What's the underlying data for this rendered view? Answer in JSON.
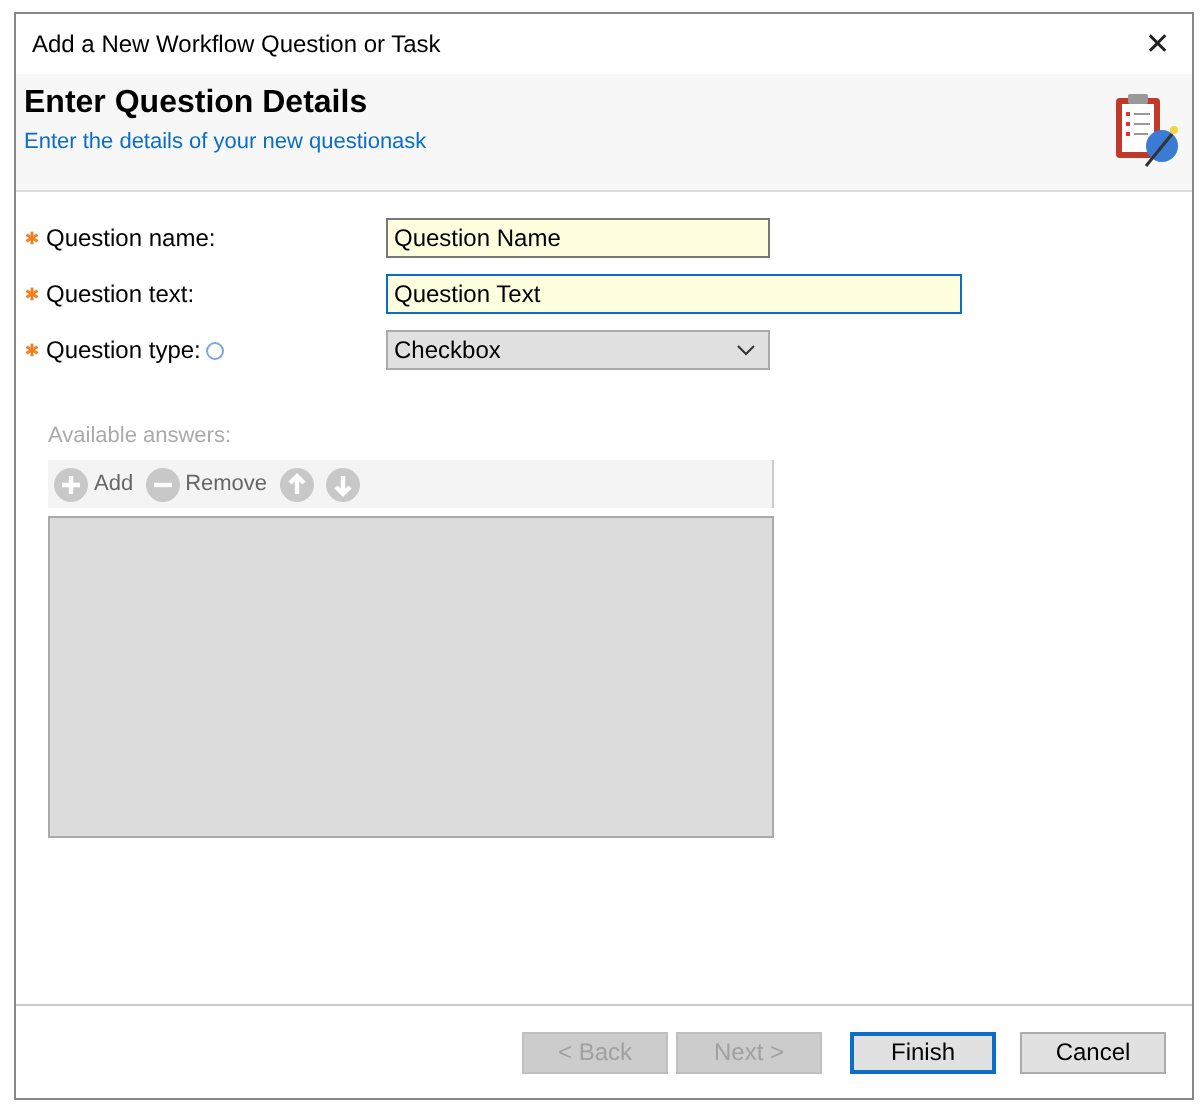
{
  "window": {
    "title": "Add a New Workflow Question or Task",
    "close": "✕"
  },
  "header": {
    "title": "Enter Question Details",
    "subtitle": "Enter the details of your new questionask"
  },
  "fields": [
    {
      "kind": "text",
      "label": "Question name:",
      "required": true,
      "value": "Question Name",
      "focused": false,
      "info": false
    },
    {
      "kind": "text",
      "label": "Question text:",
      "required": true,
      "value": "Question Text",
      "focused": true,
      "info": false
    },
    {
      "kind": "select",
      "label": "Question type:",
      "required": true,
      "value": "Checkbox",
      "focused": false,
      "info": true
    }
  ],
  "answers": {
    "label": "Available answers:",
    "disabled": true,
    "tools": [
      {
        "kind": "add",
        "label": "Add"
      },
      {
        "kind": "remove",
        "label": "Remove"
      },
      {
        "kind": "up"
      },
      {
        "kind": "down"
      }
    ]
  },
  "buttons": [
    {
      "label": "< Back",
      "disabled": true,
      "default": false
    },
    {
      "label": "Next >",
      "disabled": true,
      "default": false
    },
    {
      "label": "Finish",
      "disabled": false,
      "default": true
    },
    {
      "label": "Cancel",
      "disabled": false,
      "default": false
    }
  ]
}
